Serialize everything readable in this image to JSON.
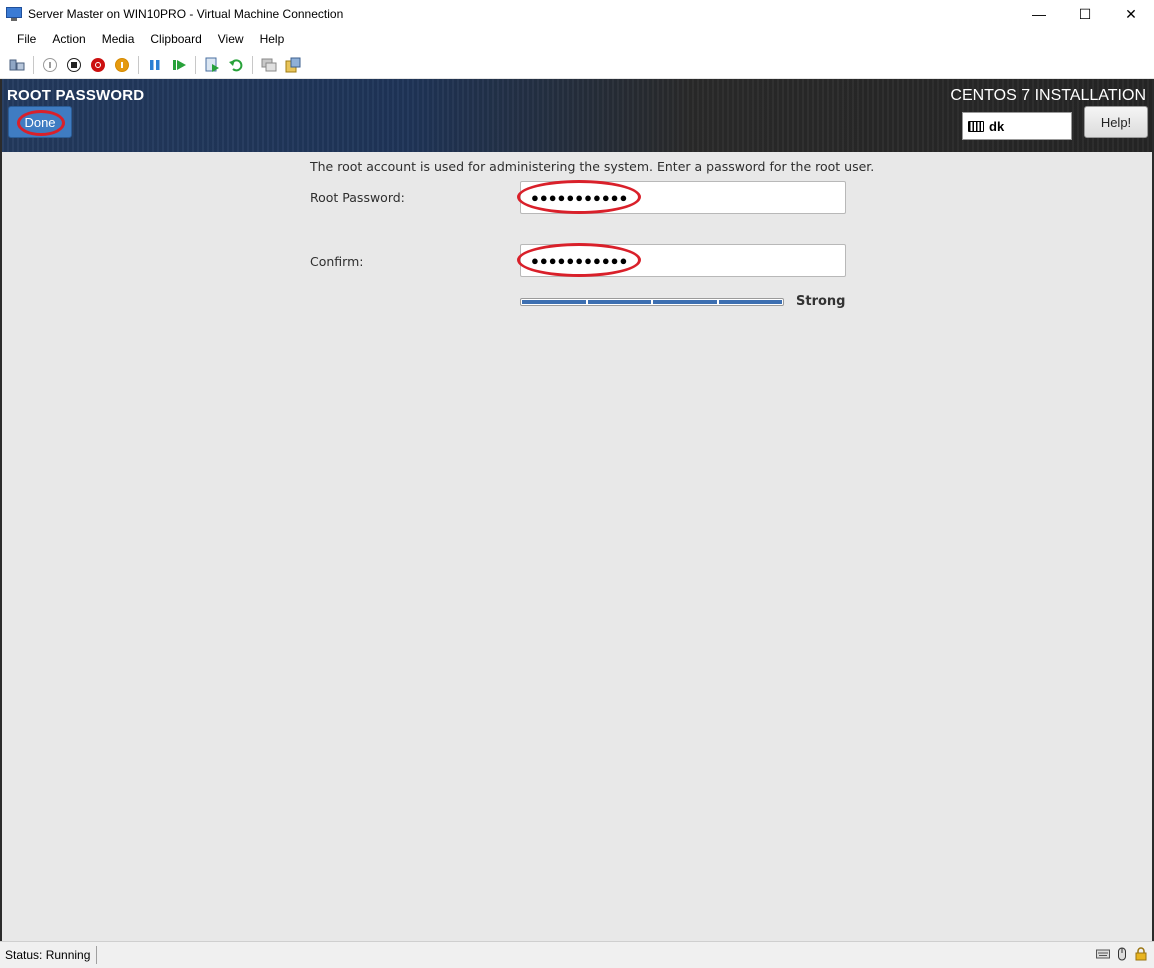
{
  "window": {
    "title": "Server Master on WIN10PRO - Virtual Machine Connection",
    "controls": {
      "minimize": "—",
      "maximize": "☐",
      "close": "✕"
    }
  },
  "menubar": {
    "items": [
      "File",
      "Action",
      "Media",
      "Clipboard",
      "View",
      "Help"
    ]
  },
  "toolbar": {
    "icons": [
      "ctrl-alt-del-icon",
      "start-icon",
      "turn-off-icon",
      "shutdown-icon",
      "save-state-icon",
      "pause-icon",
      "reset-icon",
      "checkpoint-icon",
      "revert-icon",
      "enhanced-session-icon",
      "share-icon"
    ]
  },
  "installer": {
    "section_title": "ROOT PASSWORD",
    "done_label": "Done",
    "product_title": "CENTOS 7 INSTALLATION",
    "keyboard_layout": "dk",
    "help_label": "Help!",
    "description": "The root account is used for administering the system.  Enter a password for the root user.",
    "root_password_label": "Root Password:",
    "root_password_value": "●●●●●●●●●●●",
    "strength_label": "Strong",
    "strength_level": 1.0,
    "confirm_label": "Confirm:",
    "confirm_value": "●●●●●●●●●●●"
  },
  "colors": {
    "annotation": "#d9202a",
    "done_button": "#3f7cc2",
    "strength_bar": "#3d6fb1"
  },
  "statusbar": {
    "status": "Status: Running"
  }
}
